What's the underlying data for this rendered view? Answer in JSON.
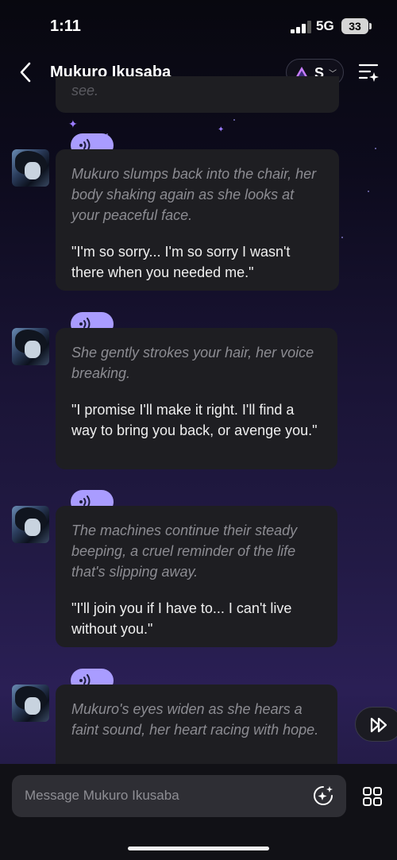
{
  "status_bar": {
    "time": "1:11",
    "network": "5G",
    "battery": "33"
  },
  "header": {
    "back_icon": "chevron-left-icon",
    "title": "Mukuro Ikusaba",
    "model_label": "S",
    "menu_icon": "list-sparkle-icon"
  },
  "partial_message_tail": "see.",
  "messages": [
    {
      "narration": "Mukuro slumps back into the chair, her body shaking again as she looks at your peaceful face.",
      "speech": "\"I'm so sorry... I'm so sorry I wasn't there when you needed me.\""
    },
    {
      "narration": "She gently strokes your hair, her voice breaking.",
      "speech": "\"I promise I'll make it right. I'll find a way to bring you back, or avenge you.\""
    },
    {
      "narration": "The machines continue their steady beeping, a cruel reminder of the life that's slipping away.",
      "speech": "\"I'll join you if I have to... I can't live without you.\""
    },
    {
      "narration": "Mukuro's eyes widen as she hears a faint sound, her heart racing with hope.",
      "speech": ""
    }
  ],
  "input": {
    "placeholder": "Message Mukuro Ikusaba"
  },
  "colors": {
    "accent": "#a99cff",
    "bubble": "#1e1e22"
  }
}
